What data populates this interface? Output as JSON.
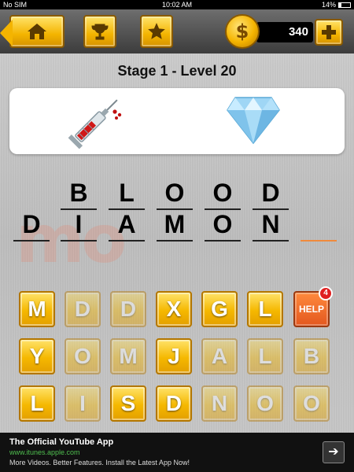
{
  "status_bar": {
    "carrier": "No SIM",
    "time": "10:02 AM",
    "battery": "14%"
  },
  "header": {
    "home_icon": "home-icon",
    "trophy_icon": "trophy-icon",
    "star_icon": "star-icon",
    "coin_symbol": "$",
    "coins": "340",
    "add_icon": "plus-icon"
  },
  "stage": {
    "title": "Stage 1 - Level 20"
  },
  "clue": {
    "icons": [
      "syringe-icon",
      "diamond-icon"
    ]
  },
  "answer": {
    "row1": [
      "B",
      "L",
      "O",
      "O",
      "D"
    ],
    "row2": [
      "D",
      "I",
      "A",
      "M",
      "O",
      "N",
      ""
    ]
  },
  "watermark": "mo",
  "tiles": {
    "row1": [
      "M",
      "D",
      "D",
      "X",
      "G",
      "L"
    ],
    "row2": [
      "Y",
      "O",
      "M",
      "J",
      "A",
      "L",
      "B"
    ],
    "row3": [
      "L",
      "I",
      "S",
      "D",
      "N",
      "O",
      "O"
    ]
  },
  "help": {
    "label": "HELP",
    "count": "4"
  },
  "ad": {
    "title": "The Official YouTube App",
    "url": "www.itunes.apple.com",
    "description": "More Videos. Better Features. Install the Latest App Now!",
    "arrow": "➔"
  },
  "colors": {
    "tile_gold": "#f5b800",
    "help_orange": "#e3571f",
    "empty_slot_line": "#f08a3c"
  }
}
